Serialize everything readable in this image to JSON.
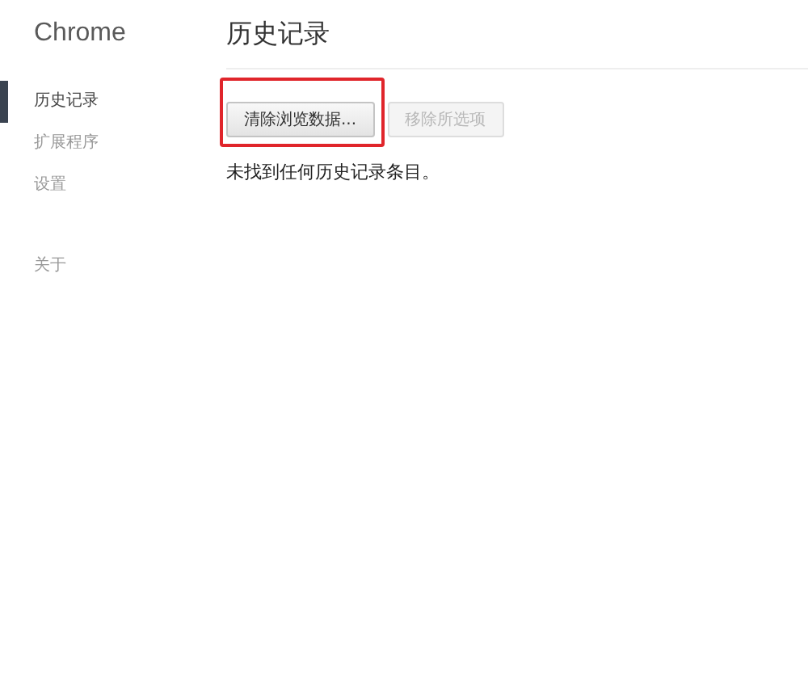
{
  "sidebar": {
    "title": "Chrome",
    "groups": [
      [
        {
          "label": "历史记录",
          "selected": true
        },
        {
          "label": "扩展程序",
          "selected": false
        },
        {
          "label": "设置",
          "selected": false
        }
      ],
      [
        {
          "label": "关于",
          "selected": false
        }
      ]
    ]
  },
  "main": {
    "title": "历史记录",
    "buttons": [
      {
        "label": "清除浏览数据...",
        "disabled": false,
        "highlighted": true
      },
      {
        "label": "移除所选项",
        "disabled": true,
        "highlighted": false
      }
    ],
    "message": "未找到任何历史记录条目。"
  }
}
